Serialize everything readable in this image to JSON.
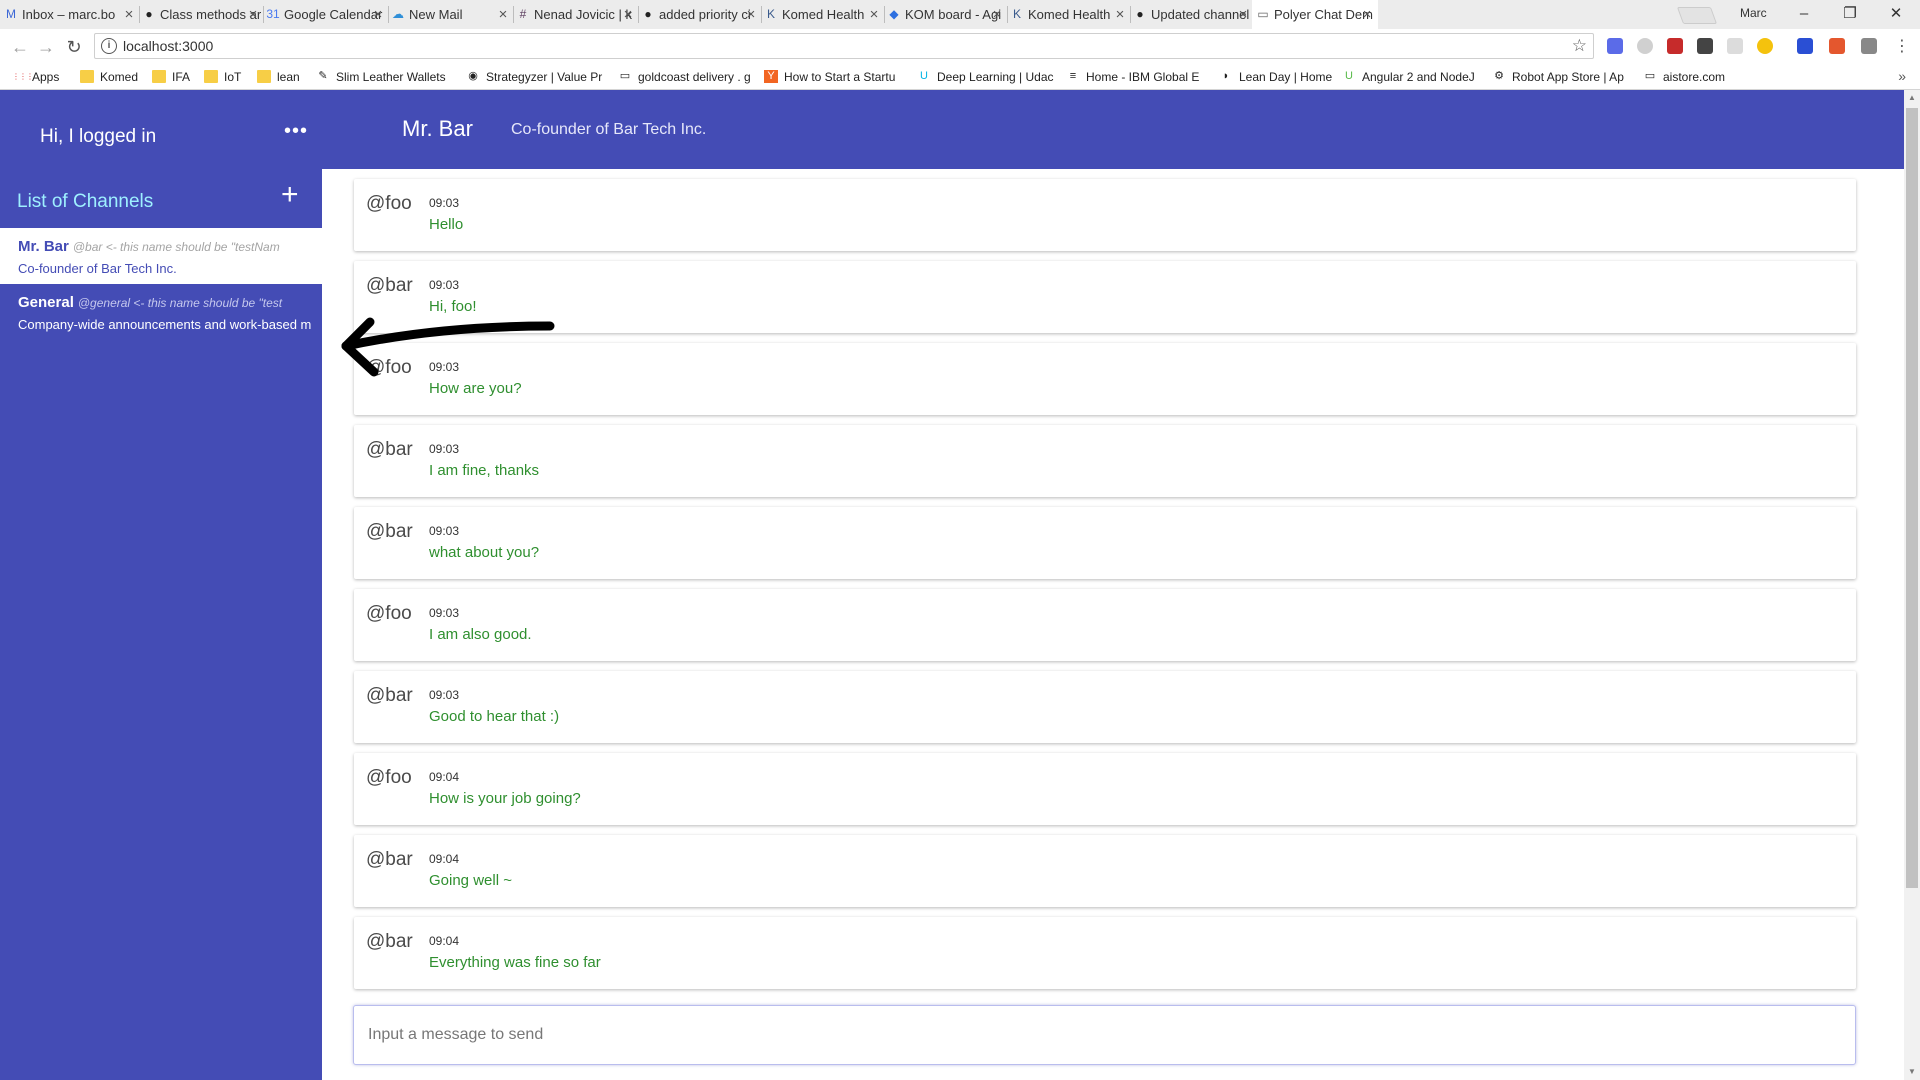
{
  "browser": {
    "tabs": [
      {
        "label": "Inbox – marc.bo",
        "icon": "gmail-icon",
        "icon_color": "#3c67d6"
      },
      {
        "label": "Class methods ar",
        "icon": "github-icon",
        "icon_color": "#222222"
      },
      {
        "label": "Google Calendar",
        "icon": "calendar-icon",
        "icon_color": "#4a7af0"
      },
      {
        "label": "New Mail",
        "icon": "cloud-mail-icon",
        "icon_color": "#2f8fd8"
      },
      {
        "label": "Nenad Jovicic | k",
        "icon": "slack-hash-icon",
        "icon_color": "#5b3c5e"
      },
      {
        "label": "added priority ci",
        "icon": "github-icon",
        "icon_color": "#222222"
      },
      {
        "label": "Komed Health",
        "icon": "komed-icon",
        "icon_color": "#3a5a8c"
      },
      {
        "label": "KOM board - Agi",
        "icon": "jira-icon",
        "icon_color": "#2d6fe0"
      },
      {
        "label": "Komed Health",
        "icon": "komed-icon",
        "icon_color": "#3a5a8c"
      },
      {
        "label": "Updated channel",
        "icon": "github-icon",
        "icon_color": "#222222"
      },
      {
        "label": "Polyer Chat Dem",
        "icon": "page-icon",
        "icon_color": "#666666",
        "active": true
      }
    ],
    "window_label": "Marc",
    "url": "localhost:3000",
    "bookmarks": [
      {
        "label": "Apps",
        "icon": "apps-grid-icon"
      },
      {
        "label": "Komed",
        "icon": "folder-icon"
      },
      {
        "label": "IFA",
        "icon": "folder-icon"
      },
      {
        "label": "IoT",
        "icon": "folder-icon"
      },
      {
        "label": "lean",
        "icon": "folder-icon"
      },
      {
        "label": "Slim Leather Wallets",
        "icon": "wallet-icon"
      },
      {
        "label": "Strategyzer | Value Pr",
        "icon": "strategyzer-icon"
      },
      {
        "label": "goldcoast delivery . g",
        "icon": "page-icon"
      },
      {
        "label": "How to Start a Startu",
        "icon": "ycombinator-icon"
      },
      {
        "label": "Deep Learning | Udac",
        "icon": "udacity-icon"
      },
      {
        "label": "Home - IBM Global E",
        "icon": "ibm-icon"
      },
      {
        "label": "Lean Day | Home",
        "icon": "leanday-icon"
      },
      {
        "label": "Angular 2 and NodeJ",
        "icon": "udemy-icon"
      },
      {
        "label": "Robot App Store | Ap",
        "icon": "robot-icon"
      },
      {
        "label": "aistore.com",
        "icon": "page-icon"
      }
    ]
  },
  "sidebar": {
    "login_text": "Hi, I logged in",
    "menu_glyph": "•••",
    "channels_title": "List of Channels",
    "add_glyph": "+",
    "channels": [
      {
        "name": "Mr. Bar",
        "handle": "@bar <- this name should be \"testNam",
        "description": "Co-founder of Bar Tech Inc.",
        "active": true
      },
      {
        "name": "General",
        "handle": "@general <- this name should be \"test",
        "description": "Company-wide announcements and work-based m",
        "active": false
      }
    ]
  },
  "header": {
    "title": "Mr. Bar",
    "subtitle": "Co-founder of Bar Tech Inc."
  },
  "messages": [
    {
      "sender": "@foo",
      "time": "09:03",
      "text": "Hello"
    },
    {
      "sender": "@bar",
      "time": "09:03",
      "text": "Hi, foo!"
    },
    {
      "sender": "@foo",
      "time": "09:03",
      "text": "How are you?"
    },
    {
      "sender": "@bar",
      "time": "09:03",
      "text": "I am fine, thanks"
    },
    {
      "sender": "@bar",
      "time": "09:03",
      "text": "what about you?"
    },
    {
      "sender": "@foo",
      "time": "09:03",
      "text": "I am also good."
    },
    {
      "sender": "@bar",
      "time": "09:03",
      "text": "Good to hear that :)"
    },
    {
      "sender": "@foo",
      "time": "09:04",
      "text": "How is your job going?"
    },
    {
      "sender": "@bar",
      "time": "09:04",
      "text": "Going well ~"
    },
    {
      "sender": "@bar",
      "time": "09:04",
      "text": "Everything was fine so far"
    }
  ],
  "composer": {
    "placeholder": "Input a message to send"
  },
  "colors": {
    "primary": "#444cb5",
    "channels_title": "#9ef0ff",
    "message_text": "#2f8f2f",
    "annotation_arrow": "#000000"
  }
}
